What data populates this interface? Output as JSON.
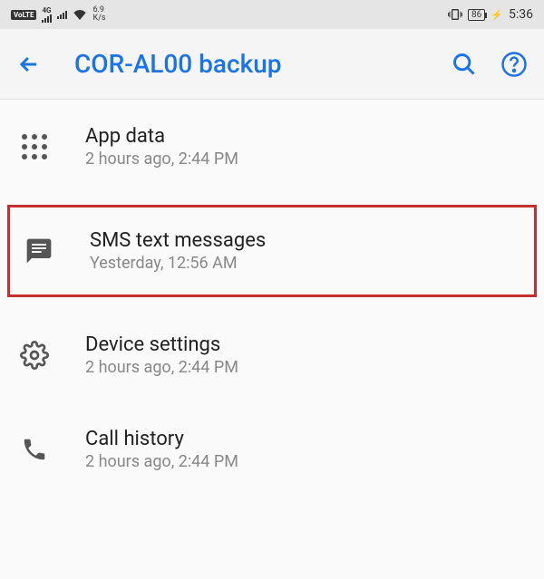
{
  "status_bar": {
    "volte": "VoLTE",
    "network_type": "4G",
    "speed_top": "6.9",
    "speed_bottom": "K/s",
    "battery": "86",
    "time": "5:36"
  },
  "app_bar": {
    "title": "COR-AL00 backup"
  },
  "items": [
    {
      "title": "App data",
      "subtitle": "2 hours ago, 2:44 PM"
    },
    {
      "title": "SMS text messages",
      "subtitle": "Yesterday, 12:56 AM"
    },
    {
      "title": "Device settings",
      "subtitle": "2 hours ago, 2:44 PM"
    },
    {
      "title": "Call history",
      "subtitle": "2 hours ago, 2:44 PM"
    }
  ]
}
